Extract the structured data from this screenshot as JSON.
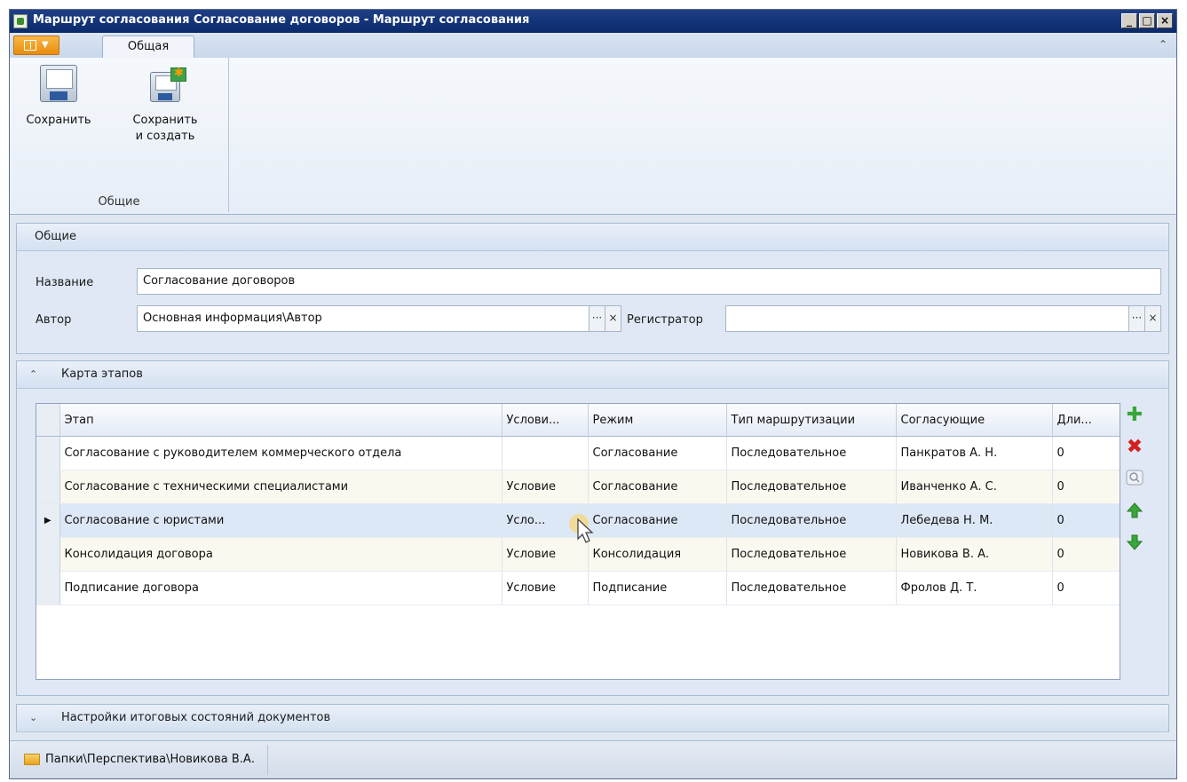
{
  "window": {
    "title": "Маршрут согласования Согласование договоров - Маршрут согласования",
    "controls": [
      "_",
      "□",
      "×"
    ]
  },
  "ribbon": {
    "tab": "Общая",
    "collapse_glyph": "⌃",
    "group_label": "Общие",
    "save_label": "Сохранить",
    "save_create_label_1": "Сохранить",
    "save_create_label_2": "и создать"
  },
  "general": {
    "header": "Общие",
    "name_label": "Название",
    "name_value": "Согласование договоров",
    "author_label": "Автор",
    "author_value": "Основная информация\\Автор",
    "registrar_label": "Регистратор",
    "registrar_value": "",
    "ellipsis": "···",
    "clear": "×"
  },
  "stages": {
    "header": "Карта этапов",
    "chevron": "⌃",
    "columns": [
      "Этап",
      "Услови...",
      "Режим",
      "Тип маршрутизации",
      "Согласующие",
      "Дли..."
    ],
    "rows": [
      [
        "Согласование с руководителем коммерческого отдела",
        "",
        "Согласование",
        "Последовательное",
        "Панкратов А. Н.",
        "0"
      ],
      [
        "Согласование с техническими специалистами",
        "Условие",
        "Согласование",
        "Последовательное",
        "Иванченко А. С.",
        "0"
      ],
      [
        "Согласование с юристами",
        "Усло...",
        "Согласование",
        "Последовательное",
        "Лебедева Н. М.",
        "0"
      ],
      [
        "Консолидация договора",
        "Условие",
        "Консолидация",
        "Последовательное",
        "Новикова В. А.",
        "0"
      ],
      [
        "Подписание договора",
        "Условие",
        "Подписание",
        "Последовательное",
        "Фролов Д. Т.",
        "0"
      ]
    ],
    "current_row_marker": "▶"
  },
  "final_states": {
    "header": "Настройки итоговых состояний документов",
    "chevron": "⌄"
  },
  "status": {
    "path": "Папки\\Перспектива\\Новикова В.А."
  },
  "colors": {
    "title_bar": "#0b2a6b",
    "app_button": "#f0a030",
    "add": "#3aa53a",
    "delete": "#d42020"
  }
}
